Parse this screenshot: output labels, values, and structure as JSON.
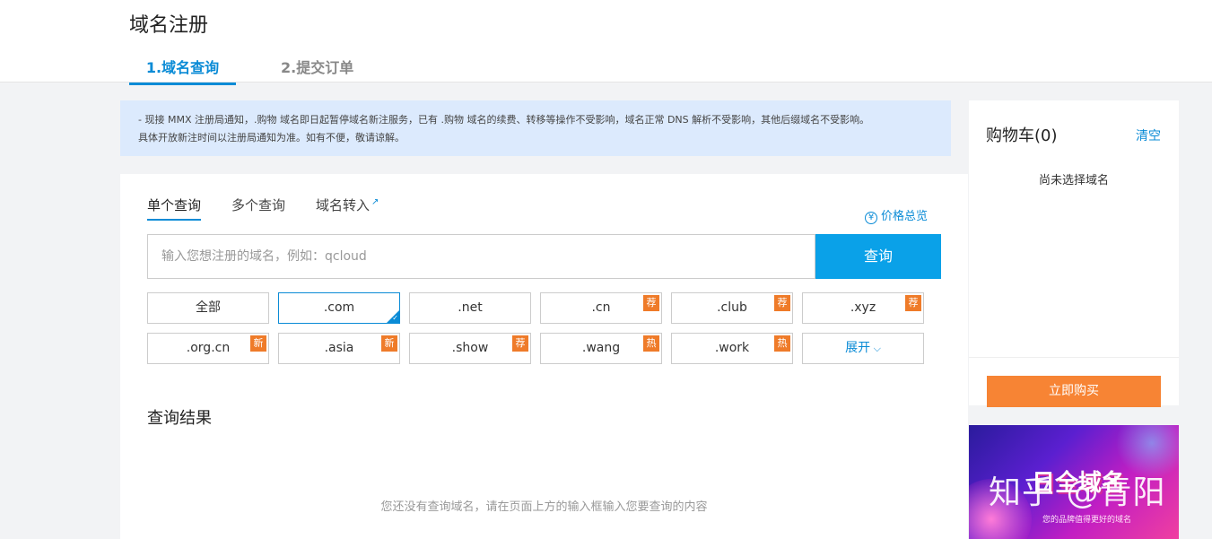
{
  "header": {
    "title": "域名注册",
    "steps": [
      "1.域名查询",
      "2.提交订单"
    ]
  },
  "notice": {
    "line1": "- 现接 MMX 注册局通知，.购物 域名即日起暂停域名新注服务，已有 .购物 域名的续费、转移等操作不受影响，域名正常 DNS 解析不受影响，其他后缀域名不受影响。",
    "line2": "具体开放新注时间以注册局通知为准。如有不便，敬请谅解。"
  },
  "search": {
    "tabs": [
      "单个查询",
      "多个查询",
      "域名转入"
    ],
    "price_overview": "价格总览",
    "placeholder": "输入您想注册的域名，例如：qcloud",
    "button": "查询"
  },
  "suffixes": [
    {
      "label": "全部",
      "badge": ""
    },
    {
      "label": ".com",
      "badge": "",
      "selected": true
    },
    {
      "label": ".net",
      "badge": ""
    },
    {
      "label": ".cn",
      "badge": "荐"
    },
    {
      "label": ".club",
      "badge": "荐"
    },
    {
      "label": ".xyz",
      "badge": "荐"
    },
    {
      "label": ".org.cn",
      "badge": "新"
    },
    {
      "label": ".asia",
      "badge": "新"
    },
    {
      "label": ".show",
      "badge": "荐"
    },
    {
      "label": ".wang",
      "badge": "热"
    },
    {
      "label": ".work",
      "badge": "热"
    }
  ],
  "expand_label": "展开",
  "results": {
    "title": "查询结果",
    "empty": "您还没有查询域名，请在页面上方的输入框输入您要查询的内容"
  },
  "cart": {
    "title": "购物车(0)",
    "clear": "清空",
    "empty": "尚未选择域名",
    "buy": "立即购买"
  },
  "banner": {
    "headline": "日全域名",
    "tagline": "您的品牌值得更好的域名",
    "watermark": "知乎 @青阳"
  },
  "colors": {
    "accent": "#0a8bd6",
    "search_button": "#0aa1e8",
    "buy_button": "#f78434",
    "badge": "#ef7b29",
    "notice_bg": "#dceafd"
  }
}
